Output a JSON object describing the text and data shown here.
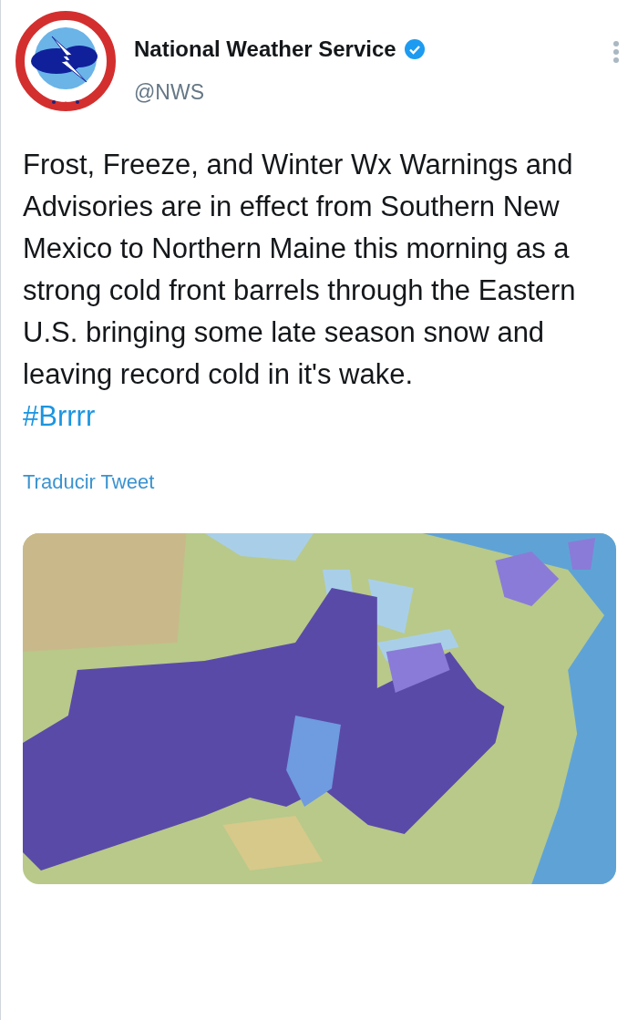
{
  "author": {
    "name": "National Weather Service",
    "verified": true,
    "handle": "@NWS"
  },
  "tweet": {
    "text": "Frost, Freeze, and Winter Wx Warnings and Advisories are in effect from Southern New Mexico to Northern Maine this morning as a strong cold front barrels through the Eastern U.S. bringing some late season snow and leaving record cold in it's wake.",
    "hashtag": "#Brrrr"
  },
  "translate_link": "Traducir Tweet"
}
